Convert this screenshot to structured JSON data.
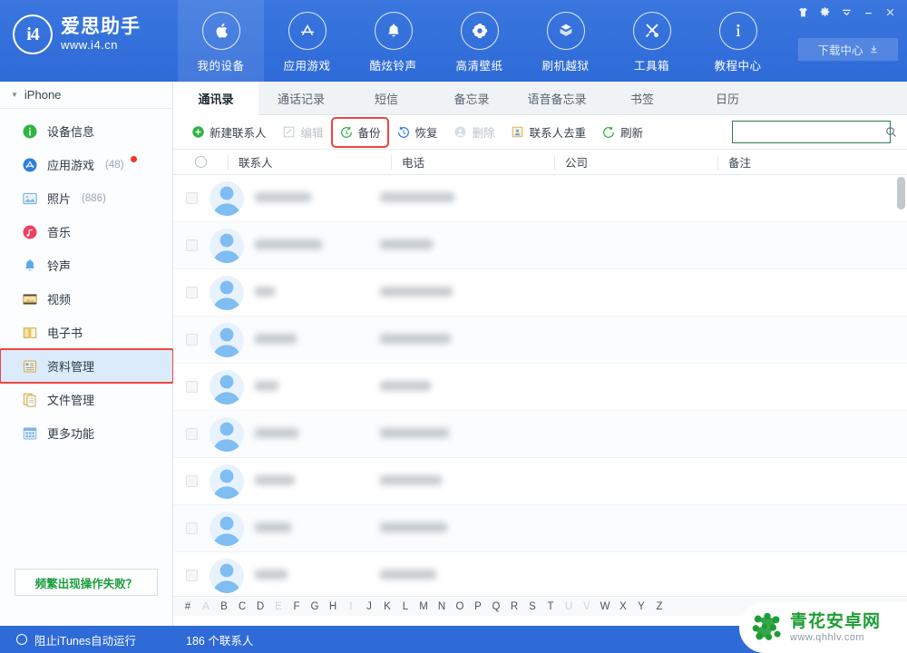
{
  "brand": {
    "logo_mark": "i4",
    "name": "爱思助手",
    "url": "www.i4.cn",
    "accent": "#2f6bd8"
  },
  "titlebar": {
    "buttons": [
      {
        "name": "skin-icon",
        "glyph": "shirt"
      },
      {
        "name": "gear-icon",
        "glyph": "gear"
      },
      {
        "name": "chevron-down-icon",
        "glyph": "chevron"
      },
      {
        "name": "minimize-icon",
        "glyph": "minimize"
      },
      {
        "name": "close-icon",
        "glyph": "close"
      }
    ],
    "download_center": "下载中心"
  },
  "topnav": {
    "items": [
      {
        "label": "我的设备",
        "icon": "apple-icon",
        "active": true
      },
      {
        "label": "应用游戏",
        "icon": "appstore-icon",
        "active": false
      },
      {
        "label": "酷炫铃声",
        "icon": "bell-icon",
        "active": false
      },
      {
        "label": "高清壁纸",
        "icon": "flower-icon",
        "active": false
      },
      {
        "label": "刷机越狱",
        "icon": "box-icon",
        "active": false
      },
      {
        "label": "工具箱",
        "icon": "tools-icon",
        "active": false
      },
      {
        "label": "教程中心",
        "icon": "info-icon",
        "active": false
      }
    ]
  },
  "sidebar": {
    "device": "iPhone",
    "items": [
      {
        "label": "设备信息",
        "count": "",
        "icon": "info-circle-icon",
        "color": "#2fb344",
        "active": false,
        "badge": false
      },
      {
        "label": "应用游戏",
        "count": "(48)",
        "icon": "appstore-icon",
        "color": "#2f7de0",
        "active": false,
        "badge": true
      },
      {
        "label": "照片",
        "count": "(886)",
        "icon": "photo-icon",
        "color": "#5ba7e8",
        "active": false,
        "badge": false
      },
      {
        "label": "音乐",
        "count": "",
        "icon": "music-icon",
        "color": "#ef4060",
        "active": false,
        "badge": false
      },
      {
        "label": "铃声",
        "count": "",
        "icon": "bell-icon",
        "color": "#5ba7e8",
        "active": false,
        "badge": false
      },
      {
        "label": "视频",
        "count": "",
        "icon": "film-icon",
        "color": "#e8b24a",
        "active": false,
        "badge": false
      },
      {
        "label": "电子书",
        "count": "",
        "icon": "book-icon",
        "color": "#e8c060",
        "active": false,
        "badge": false
      },
      {
        "label": "资料管理",
        "count": "",
        "icon": "data-icon",
        "color": "#e8c060",
        "active": true,
        "badge": false
      },
      {
        "label": "文件管理",
        "count": "",
        "icon": "files-icon",
        "color": "#e8c060",
        "active": false,
        "badge": false
      },
      {
        "label": "更多功能",
        "count": "",
        "icon": "grid-icon",
        "color": "#7fb3e0",
        "active": false,
        "badge": false
      }
    ],
    "help_button": "频繁出现操作失败？",
    "highlight_color": "#ef4444"
  },
  "tabs": [
    {
      "label": "通讯录",
      "active": true
    },
    {
      "label": "通话记录",
      "active": false
    },
    {
      "label": "短信",
      "active": false
    },
    {
      "label": "备忘录",
      "active": false
    },
    {
      "label": "语音备忘录",
      "active": false
    },
    {
      "label": "书签",
      "active": false
    },
    {
      "label": "日历",
      "active": false
    }
  ],
  "toolbar": {
    "buttons": [
      {
        "label": "新建联系人",
        "icon": "plus-circle-icon",
        "disabled": false,
        "highlight": false
      },
      {
        "label": "编辑",
        "icon": "edit-icon",
        "disabled": true,
        "highlight": false
      },
      {
        "label": "备份",
        "icon": "backup-icon",
        "disabled": false,
        "highlight": true
      },
      {
        "label": "恢复",
        "icon": "restore-icon",
        "disabled": false,
        "highlight": false
      },
      {
        "label": "删除",
        "icon": "delete-icon",
        "disabled": true,
        "highlight": false
      },
      {
        "label": "联系人去重",
        "icon": "dedupe-icon",
        "disabled": false,
        "highlight": false
      },
      {
        "label": "刷新",
        "icon": "refresh-icon",
        "disabled": false,
        "highlight": false
      }
    ]
  },
  "search": {
    "value": "",
    "placeholder": "",
    "border_color": "#2e7d4f",
    "icon": "search-icon"
  },
  "table": {
    "columns": [
      "联系人",
      "电话",
      "公司",
      "备注"
    ],
    "select_all_checked": false,
    "rows": [
      {
        "name_w": 62,
        "phone_w": 82,
        "company_w": 0,
        "note_w": 0,
        "alt": false
      },
      {
        "name_w": 74,
        "phone_w": 58,
        "company_w": 0,
        "note_w": 0,
        "alt": true
      },
      {
        "name_w": 22,
        "phone_w": 80,
        "company_w": 0,
        "note_w": 0,
        "alt": false
      },
      {
        "name_w": 46,
        "phone_w": 78,
        "company_w": 0,
        "note_w": 0,
        "alt": true
      },
      {
        "name_w": 26,
        "phone_w": 56,
        "company_w": 0,
        "note_w": 0,
        "alt": false
      },
      {
        "name_w": 48,
        "phone_w": 76,
        "company_w": 0,
        "note_w": 0,
        "alt": true
      },
      {
        "name_w": 44,
        "phone_w": 68,
        "company_w": 0,
        "note_w": 0,
        "alt": false
      },
      {
        "name_w": 40,
        "phone_w": 74,
        "company_w": 0,
        "note_w": 0,
        "alt": true
      },
      {
        "name_w": 36,
        "phone_w": 62,
        "company_w": 0,
        "note_w": 0,
        "alt": false
      }
    ]
  },
  "alpha_index": [
    {
      "ch": "#",
      "on": true
    },
    {
      "ch": "A",
      "on": false
    },
    {
      "ch": "B",
      "on": true
    },
    {
      "ch": "C",
      "on": true
    },
    {
      "ch": "D",
      "on": true
    },
    {
      "ch": "E",
      "on": false
    },
    {
      "ch": "F",
      "on": true
    },
    {
      "ch": "G",
      "on": true
    },
    {
      "ch": "H",
      "on": true
    },
    {
      "ch": "I",
      "on": false
    },
    {
      "ch": "J",
      "on": true
    },
    {
      "ch": "K",
      "on": true
    },
    {
      "ch": "L",
      "on": true
    },
    {
      "ch": "M",
      "on": true
    },
    {
      "ch": "N",
      "on": true
    },
    {
      "ch": "O",
      "on": true
    },
    {
      "ch": "P",
      "on": true
    },
    {
      "ch": "Q",
      "on": true
    },
    {
      "ch": "R",
      "on": true
    },
    {
      "ch": "S",
      "on": true
    },
    {
      "ch": "T",
      "on": true
    },
    {
      "ch": "U",
      "on": false
    },
    {
      "ch": "V",
      "on": false
    },
    {
      "ch": "W",
      "on": true
    },
    {
      "ch": "X",
      "on": true
    },
    {
      "ch": "Y",
      "on": true
    },
    {
      "ch": "Z",
      "on": true
    }
  ],
  "statusbar": {
    "itunes_toggle": "阻止iTunes自动运行",
    "contact_count": "186 个联系人"
  },
  "watermark": {
    "name": "青花安卓网",
    "url": "www.qhhlv.com",
    "color": "#1f9d35"
  }
}
